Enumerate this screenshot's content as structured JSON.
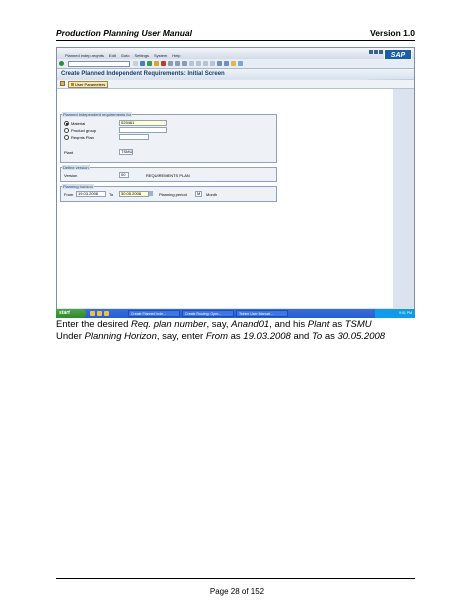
{
  "header": {
    "title": "Production Planning User Manual",
    "version": "Version 1.0"
  },
  "sap_window": {
    "menu": [
      "Planned indep.reqmts",
      "Edit",
      "Goto",
      "Settings",
      "System",
      "Help"
    ],
    "logo": "SAP",
    "screen_title": "Create Planned Independent Requirements: Initial Screen",
    "app_toolbar_button": "User Parameters",
    "group_reqs": {
      "title": "Planned independent requirements for",
      "material_label": "Material",
      "material_value": "029461",
      "product_group_label": "Product group",
      "reqmts_plan_label": "Reqmts Plan",
      "plant_label": "Plant",
      "plant_value": "TSMU"
    },
    "group_version": {
      "title": "Define version",
      "version_label": "Version",
      "version_value": "00",
      "version_desc": "REQUIREMENTS PLAN"
    },
    "group_horizon": {
      "title": "Planning horizon",
      "from_label": "From",
      "from_value": "19.03.2008",
      "to_label": "To",
      "to_value": "30.05.2008",
      "period_label": "Planning period",
      "period_value": "M",
      "period_desc": "Month"
    },
    "status": {
      "system": "DEV (1) 400",
      "server": "fetrmader",
      "mode": "INS"
    }
  },
  "taskbar": {
    "start": "start",
    "tasks": [
      "Create Planned Inde...",
      "Create Routing: Oper...",
      "Telnire User Manual..."
    ],
    "clock": "9:01 PM"
  },
  "caption": {
    "line1_pre": "Enter the desired ",
    "line1_em1": "Req. plan number",
    "line1_mid1": ", say, ",
    "line1_em2": "Anand01",
    "line1_mid2": ", and his ",
    "line1_em3": "Plant",
    "line1_mid3": " as ",
    "line1_em4": "TSMU",
    "line2_pre": "Under ",
    "line2_em1": "Planning Horizon",
    "line2_mid1": ", say, enter ",
    "line2_em2": "From",
    "line2_mid2": " as ",
    "line2_em3": "19.03.2008",
    "line2_mid3": " and ",
    "line2_em4": "To",
    "line2_mid4": " as ",
    "line2_em5": "30.05.2008"
  },
  "footer": {
    "page": "Page 28 of 152"
  }
}
